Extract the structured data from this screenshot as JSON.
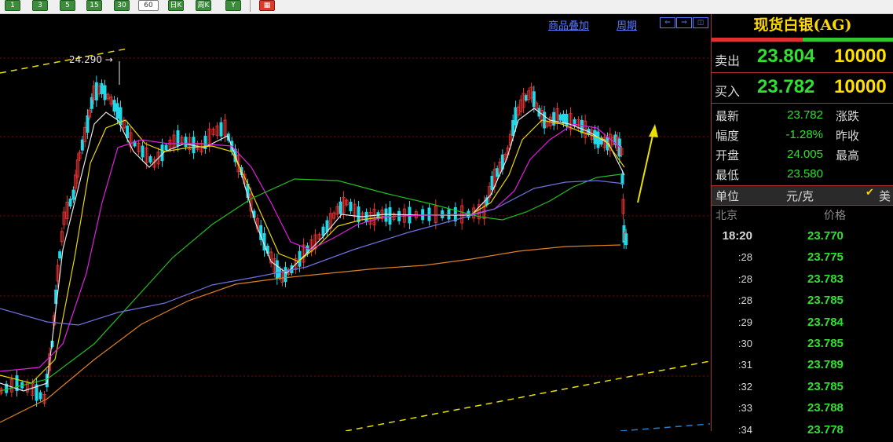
{
  "toolbar": {
    "periods": [
      "1",
      "3",
      "5",
      "15",
      "30",
      "60",
      "日K",
      "周K",
      "Y"
    ],
    "selected": "60"
  },
  "chart": {
    "overlay_link": "商品叠加",
    "period_link": "周期",
    "high_marker": "24.290 →",
    "colors": {
      "up": "#e03030",
      "down": "#20d8e8",
      "ma_white": "#e8e8e8",
      "ma_yellow": "#e8d800",
      "ma_magenta": "#e020e0",
      "ma_green": "#20c020",
      "ma_blue": "#7070e0",
      "ma_orange": "#e08020",
      "trendline": "#e8e000",
      "grid": "#8a0000"
    }
  },
  "panel": {
    "title": "现货白银(AG)",
    "sell": {
      "label": "卖出",
      "price": "23.804",
      "volume": "10000"
    },
    "buy": {
      "label": "买入",
      "price": "23.782",
      "volume": "10000"
    },
    "info": [
      {
        "label": "最新",
        "value": "23.782",
        "label2": "涨跌"
      },
      {
        "label": "幅度",
        "value": "-1.28%",
        "label2": "昨收"
      },
      {
        "label": "开盘",
        "value": "24.005",
        "label2": "最高"
      },
      {
        "label": "最低",
        "value": "23.580",
        "label2": ""
      }
    ],
    "unit": {
      "label": "单位",
      "value": "元/克",
      "usd_label": "美"
    },
    "ticks_header": {
      "location": "北京",
      "price": "价格"
    },
    "ticks": [
      {
        "time": "18:20",
        "price": "23.770"
      },
      {
        "time": ":28",
        "price": "23.775"
      },
      {
        "time": ":28",
        "price": "23.783"
      },
      {
        "time": ":28",
        "price": "23.785"
      },
      {
        "time": ":29",
        "price": "23.784"
      },
      {
        "time": ":30",
        "price": "23.785"
      },
      {
        "time": ":31",
        "price": "23.789"
      },
      {
        "time": ":32",
        "price": "23.785"
      },
      {
        "time": ":33",
        "price": "23.788"
      },
      {
        "time": ":34",
        "price": "23.778"
      }
    ]
  }
}
